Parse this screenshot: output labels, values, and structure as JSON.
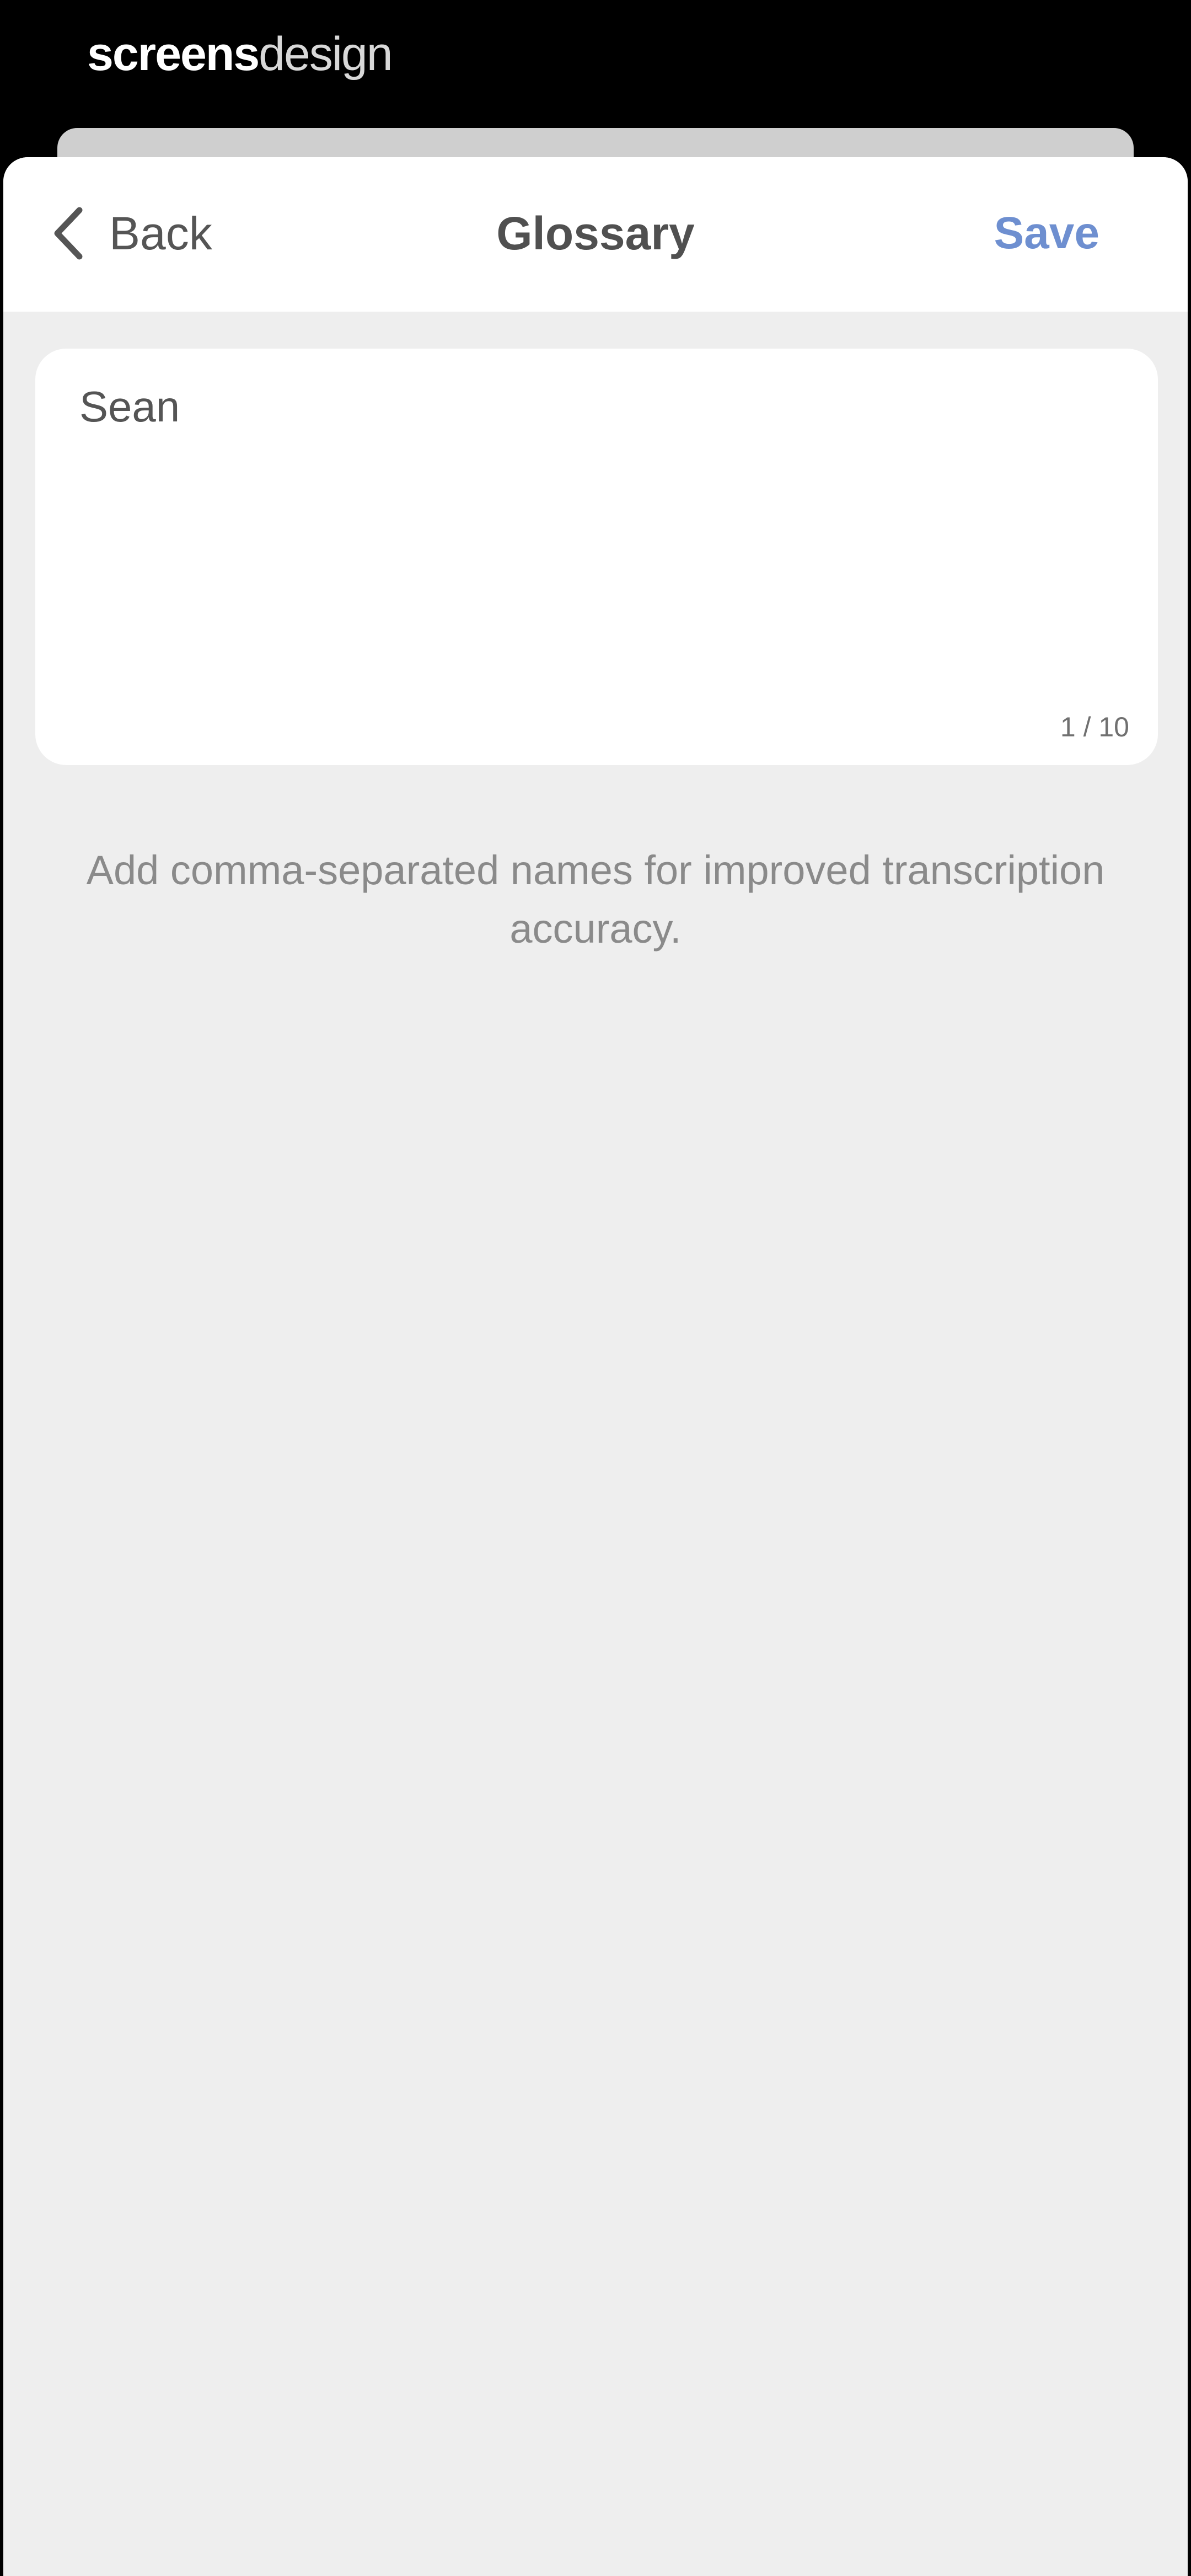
{
  "watermark": {
    "part1": "screens",
    "part2": "design"
  },
  "navbar": {
    "back_label": "Back",
    "title": "Glossary",
    "save_label": "Save"
  },
  "glossary_field": {
    "value": "Sean",
    "counter": "1 / 10"
  },
  "hint": "Add comma-separated names for improved transcription accuracy.",
  "colors": {
    "accent": "#6e8fd0",
    "background": "#eeeeee",
    "surface": "#ffffff"
  },
  "icons": {
    "back": "chevron-left-icon"
  }
}
